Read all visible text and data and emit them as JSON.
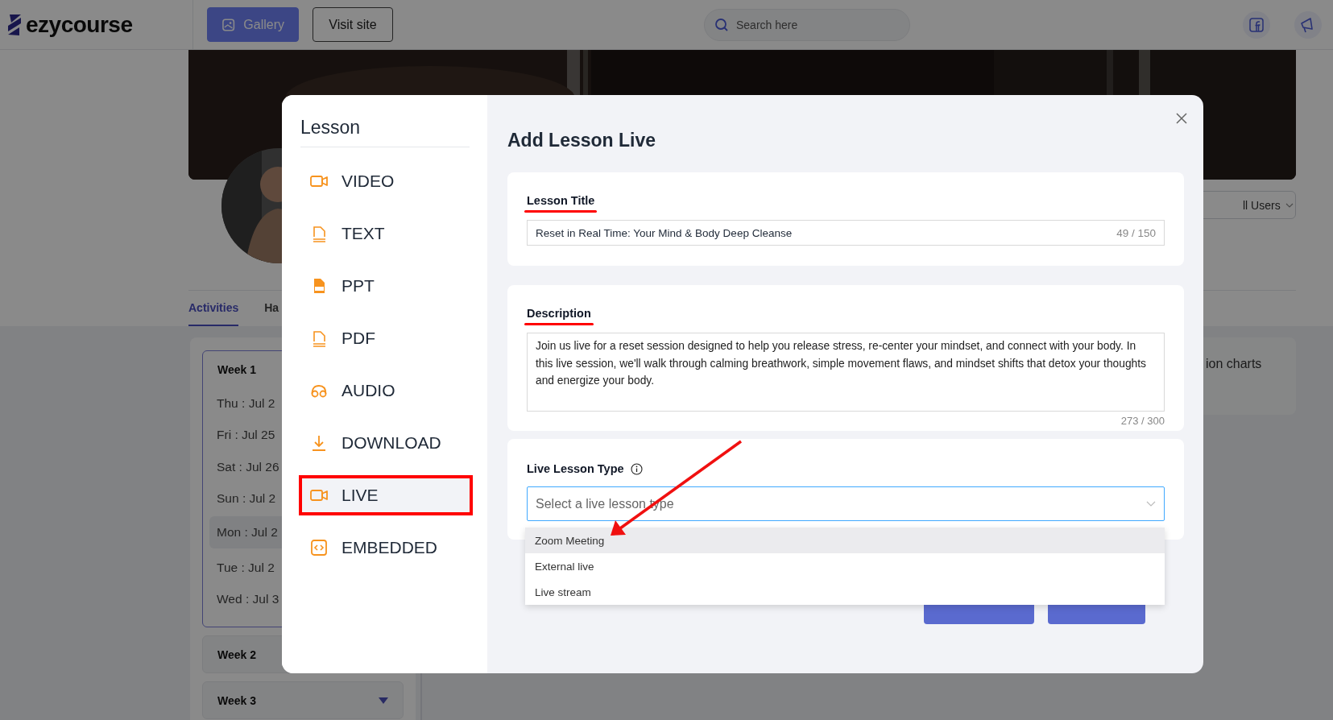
{
  "header": {
    "logo": "ezycourse",
    "buttons": [
      {
        "label": "Gallery",
        "kind": "primary"
      },
      {
        "label": "Visit site",
        "kind": "outline"
      }
    ],
    "search": {
      "placeholder": "Search here"
    }
  },
  "profile": {
    "audience_filter": "ll Users",
    "tabs": [
      {
        "label": "Activities",
        "selected": true
      },
      {
        "label": "Ha",
        "selected": false
      }
    ]
  },
  "schedule": {
    "weeks": [
      {
        "label": "Week 1",
        "expanded": true,
        "days": [
          {
            "label": "Thu : Jul 2",
            "selected": false
          },
          {
            "label": "Fri : Jul 25",
            "selected": false
          },
          {
            "label": "Sat : Jul 26",
            "selected": false
          },
          {
            "label": "Sun : Jul 2",
            "selected": false
          },
          {
            "label": "Mon : Jul 2",
            "selected": true
          },
          {
            "label": "Tue : Jul 2",
            "selected": false
          },
          {
            "label": "Wed : Jul 3",
            "selected": false
          }
        ]
      },
      {
        "label": "Week 2",
        "expanded": false
      },
      {
        "label": "Week 3",
        "expanded": false
      }
    ]
  },
  "side_card": {
    "text": "ion charts"
  },
  "modal": {
    "sidebar": {
      "title": "Lesson",
      "items": [
        {
          "label": "VIDEO",
          "kind": "video",
          "selected": false
        },
        {
          "label": "TEXT",
          "kind": "text",
          "selected": false
        },
        {
          "label": "PPT",
          "kind": "ppt",
          "selected": false
        },
        {
          "label": "PDF",
          "kind": "pdf",
          "selected": false
        },
        {
          "label": "AUDIO",
          "kind": "audio",
          "selected": false
        },
        {
          "label": "DOWNLOAD",
          "kind": "download",
          "selected": false
        },
        {
          "label": "LIVE",
          "kind": "live",
          "selected": true
        },
        {
          "label": "EMBEDDED",
          "kind": "embedded",
          "selected": false
        }
      ]
    },
    "title": "Add Lesson Live",
    "lesson_title": {
      "label": "Lesson Title",
      "value": "Reset in Real Time: Your Mind & Body Deep Cleanse",
      "counter": "49 / 150"
    },
    "description": {
      "label": "Description",
      "value": "Join us live for a reset session designed to help you release stress, re-center your mindset, and connect with your body. In this live session, we'll walk through calming breathwork, simple movement flaws, and mindset shifts that detox your thoughts and energize your body.",
      "counter": "273 / 300"
    },
    "live_lesson_type": {
      "label": "Live Lesson Type",
      "placeholder": "Select a live lesson type",
      "options": [
        {
          "label": "Zoom Meeting",
          "selected": true
        },
        {
          "label": "External live",
          "selected": false
        },
        {
          "label": "Live stream",
          "selected": false
        }
      ]
    }
  }
}
